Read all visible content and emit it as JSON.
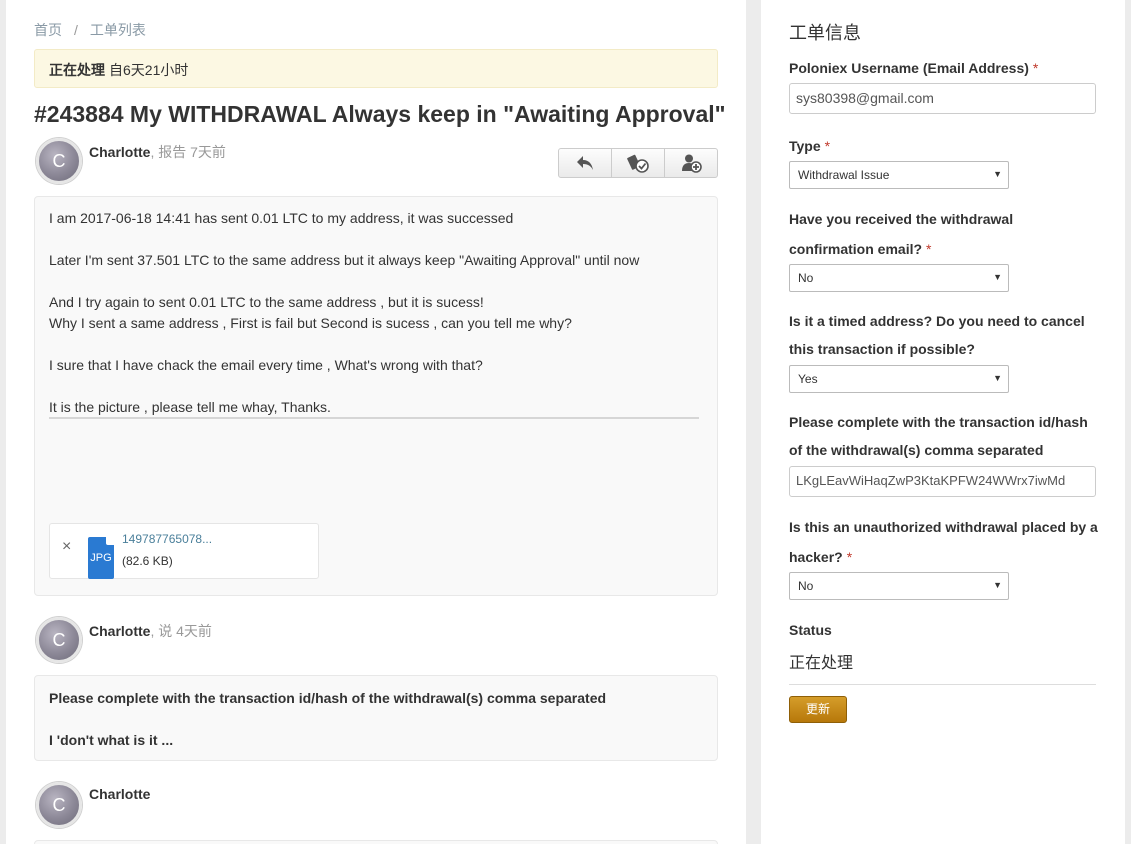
{
  "breadcrumb": {
    "home": "首页",
    "separator": "/",
    "list": "工单列表"
  },
  "status_bar": {
    "state": "正在处理",
    "duration": "自6天21小时"
  },
  "ticket": {
    "title": "#243884 My WITHDRAWAL Always keep in \"Awaiting Approval\""
  },
  "posts": [
    {
      "avatar_letter": "C",
      "author": "Charlotte",
      "action": ", 报告 7天前",
      "lines": [
        "I am 2017-06-18 14:41 has sent 0.01 LTC to my address, it was successed",
        "Later  I'm sent  37.501 LTC to the same address  but it always keep \"Awaiting Approval\"  until now",
        "And I try again to sent 0.01 LTC  to the same address , but it is sucess!",
        "Why  I sent a same address , First is fail   but   Second is sucess , can you tell me why?",
        "I sure that I have chack the email  every time , What's wrong with that?",
        "It is the picture , please tell me whay, Thanks."
      ],
      "attachment": {
        "remove": "×",
        "type": "JPG",
        "name": "149787765078...",
        "size": "(82.6 KB)"
      }
    },
    {
      "avatar_letter": "C",
      "author": "Charlotte",
      "action": ", 说 4天前",
      "lines": [
        "Please complete with the transaction id/hash of the withdrawal(s) comma separated",
        "I 'don't what is it ..."
      ]
    },
    {
      "avatar_letter": "C",
      "author": "Charlotte",
      "action": ""
    }
  ],
  "sidebar": {
    "heading": "工单信息",
    "required_mark": "*",
    "fields": {
      "username": {
        "label": "Poloniex Username (Email Address)",
        "value": "sys80398@gmail.com"
      },
      "type": {
        "label": "Type",
        "value": "Withdrawal Issue"
      },
      "confirmation": {
        "label": "Have you received the withdrawal confirmation email?",
        "value": "No"
      },
      "timed": {
        "label": "Is it a timed address? Do you need to cancel this transaction if possible?",
        "value": "Yes"
      },
      "txid": {
        "label": "Please complete with the transaction id/hash of the withdrawal(s) comma separated",
        "value": "LKgLEavWiHaqZwP3KtaKPFW24WWrx7iwMd"
      },
      "hacker": {
        "label": "Is this an unauthorized withdrawal placed by a hacker?",
        "value": "No"
      }
    },
    "status_label": "Status",
    "status_value": "正在处理",
    "update_button": "更新",
    "select_arrow": "▼"
  }
}
